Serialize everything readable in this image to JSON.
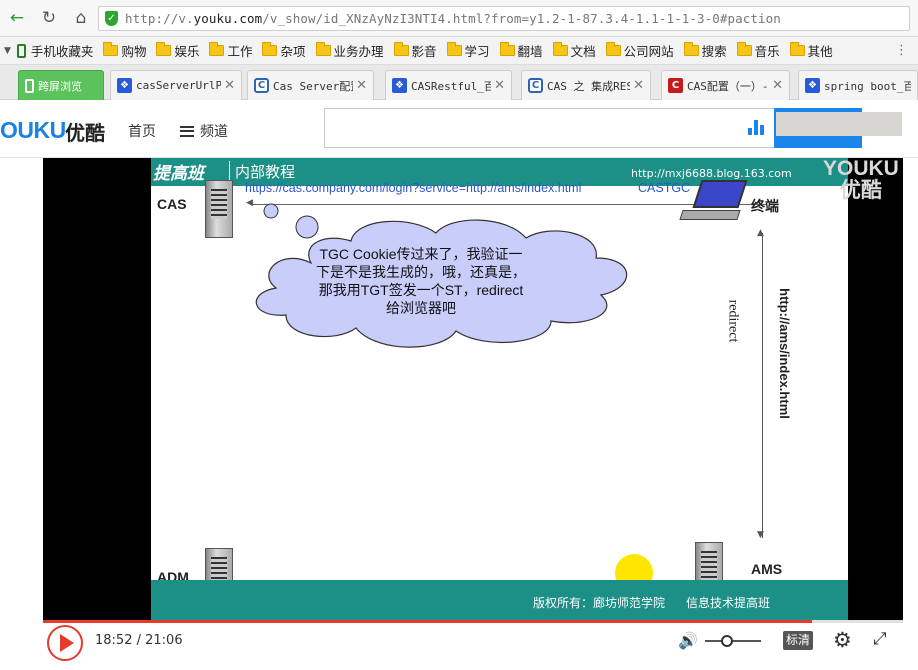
{
  "browser": {
    "url_prefix": "http://v.",
    "url_domain": "youku.com",
    "url_rest": "/v_show/id_XNzAyNzI3NTI4.html?from=y1.2-1-87.3.4-1.1-1-1-3-0#paction"
  },
  "bookmarks": [
    {
      "label": "手机收藏夹",
      "icon": "phone-icon"
    },
    {
      "label": "购物",
      "icon": "folder-icon"
    },
    {
      "label": "娱乐",
      "icon": "folder-icon"
    },
    {
      "label": "工作",
      "icon": "folder-icon"
    },
    {
      "label": "杂项",
      "icon": "folder-icon"
    },
    {
      "label": "业务办理",
      "icon": "folder-icon"
    },
    {
      "label": "影音",
      "icon": "folder-icon"
    },
    {
      "label": "学习",
      "icon": "folder-icon"
    },
    {
      "label": "翻墙",
      "icon": "folder-icon"
    },
    {
      "label": "文档",
      "icon": "folder-icon"
    },
    {
      "label": "公司网站",
      "icon": "folder-icon"
    },
    {
      "label": "搜索",
      "icon": "folder-icon"
    },
    {
      "label": "音乐",
      "icon": "folder-icon"
    },
    {
      "label": "其他",
      "icon": "folder-icon"
    }
  ],
  "tabs": [
    {
      "label": "跨屏浏览",
      "icon": "phone-icon"
    },
    {
      "label": "casServerUrlPr",
      "icon": "baidu-paw-icon"
    },
    {
      "label": "Cas Server配置",
      "icon": "cnblogs-icon"
    },
    {
      "label": "CASRestful_百",
      "icon": "baidu-paw-icon"
    },
    {
      "label": "CAS 之 集成RES",
      "icon": "cnblogs-icon"
    },
    {
      "label": "CAS配置（一）-",
      "icon": "csdn-icon"
    },
    {
      "label": "spring boot_百",
      "icon": "baidu-paw-icon"
    }
  ],
  "youku": {
    "logo_text": "OUKU",
    "logo_cn": "优酷",
    "nav_home": "首页",
    "nav_channel": "频道",
    "search_placeholder": ""
  },
  "slide": {
    "header_title": "提高班",
    "header_subtitle": "内部教程",
    "blog_url": "http://mxj6688.blog.163.com",
    "login_url": "https://cas.company.com/login?service=http://ams/index.html",
    "castgc": "CASTGC",
    "cas_label": "CAS",
    "terminal_label": "终端",
    "bubble_line1": "TGC Cookie传过来了，我验证一",
    "bubble_line2": "下是不是我生成的，哦，还真是，",
    "bubble_line3": "那我用TGT签发一个ST，redirect",
    "bubble_line4": "给浏览器吧",
    "redirect_label": "redirect",
    "ams_index_label": "http://ams/index.html",
    "adm_label": "ADM",
    "ams_label": "AMS",
    "footer_copyright": "版权所有：廊坊师范学院",
    "footer_right": "信息技术提高班"
  },
  "watermark": {
    "line1": "YOUKU",
    "line2": "优酷"
  },
  "player": {
    "current_time": "18:52",
    "total_time": "21:06",
    "time_sep": " / ",
    "progress": 0.894,
    "volume": 0.4,
    "quality_label": "标清"
  },
  "colors": {
    "accent": "#1b86ea",
    "play_red": "#e53b2c",
    "slide_teal": "#1c8f87"
  }
}
